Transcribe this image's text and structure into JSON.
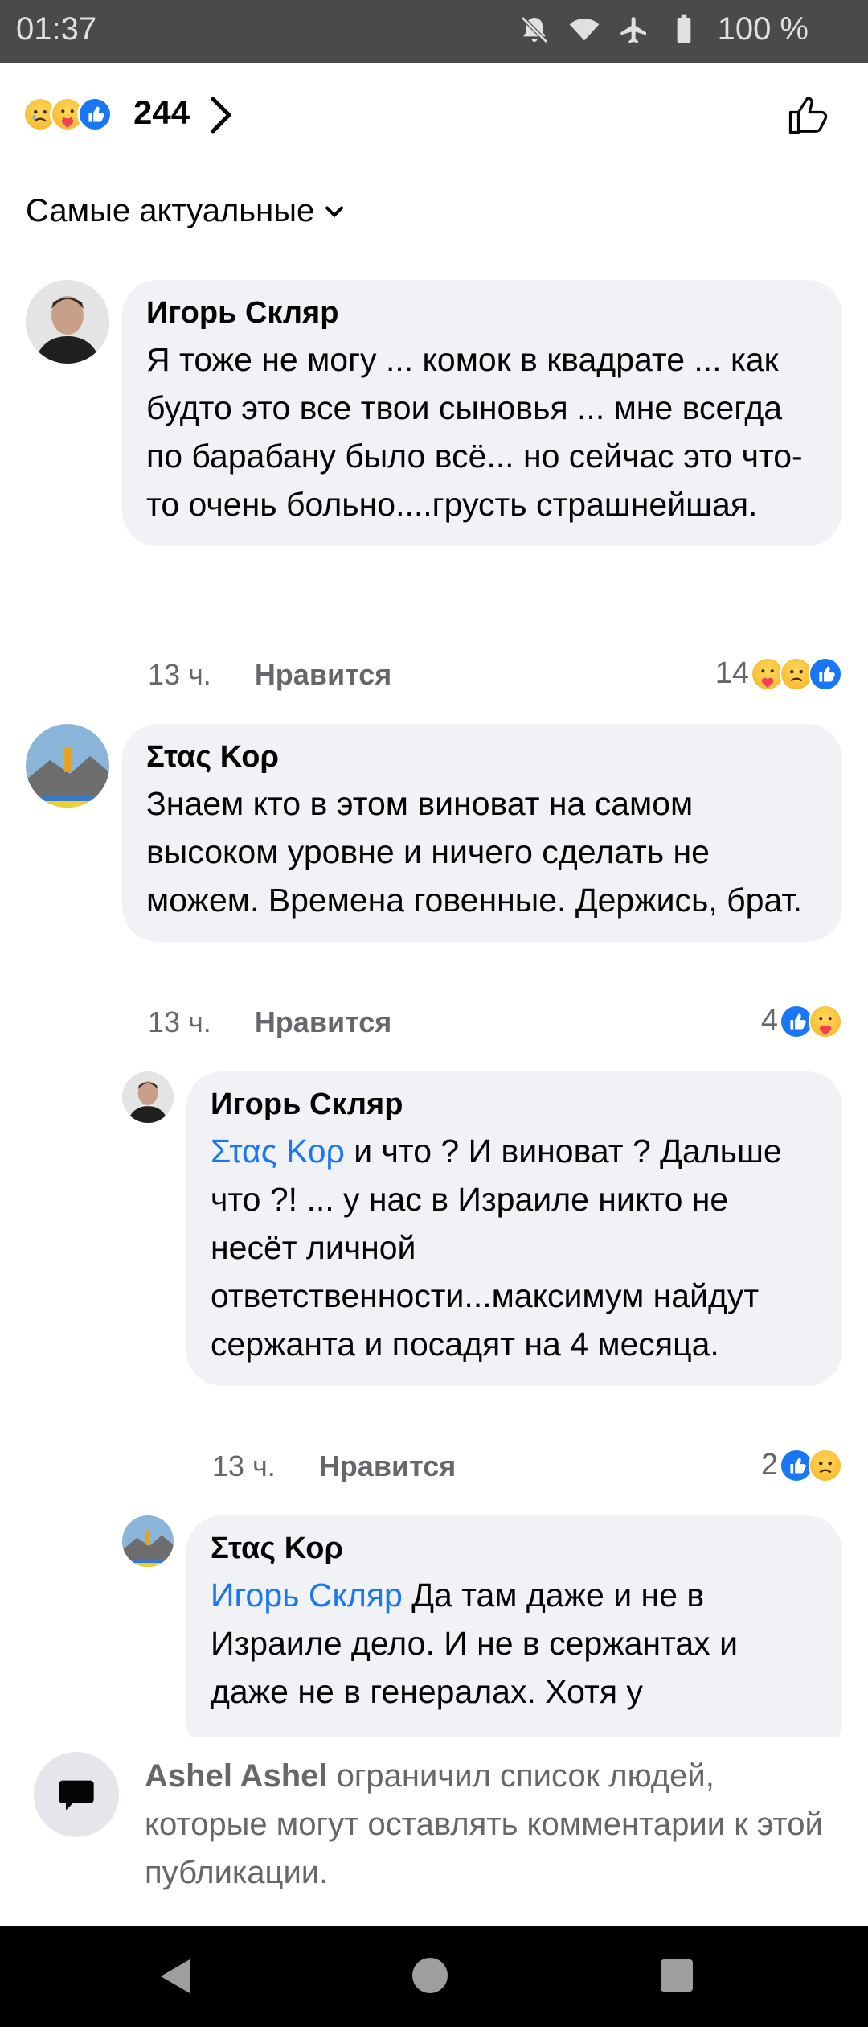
{
  "status_bar": {
    "time": "01:37",
    "battery": "100 %",
    "icons": [
      "notifications-off-icon",
      "wifi-icon",
      "airplane-icon",
      "battery-icon"
    ]
  },
  "reactions": {
    "count": "244",
    "types": [
      "sad",
      "care",
      "like"
    ]
  },
  "sort": {
    "label": "Самые актуальные"
  },
  "comments": [
    {
      "author": "Игорь Скляр",
      "text": "Я тоже не могу ... комок в квадрате ... как будто это все твои сыновья ... мне всегда по барабану было всё... но сейчас это что-то очень больно....грусть страшнейшая.",
      "time": "13 ч.",
      "like_label": "Нравится",
      "reaction_count": "14",
      "reaction_types": [
        "care",
        "sad",
        "like"
      ]
    },
    {
      "author": "Στας Κορ",
      "text": "Знаем кто в этом виноват на самом высоком уровне и ничего сделать не можем. Времена говенные. Держись, брат.",
      "time": "13 ч.",
      "like_label": "Нравится",
      "reaction_count": "4",
      "reaction_types": [
        "like",
        "care"
      ]
    },
    {
      "author": "Игорь Скляр",
      "mention": "Στας Κορ",
      "text": " и что ? И виноват ? Дальше что  ?! ... у нас в Израиле никто не несёт личной ответственности...максимум найдут сержанта и посадят на 4 месяца.",
      "time": "13 ч.",
      "like_label": "Нравится",
      "reaction_count": "2",
      "reaction_types": [
        "like",
        "sad"
      ]
    },
    {
      "author": "Στας Κορ",
      "mention": "Игорь Скляр",
      "text": " Да там даже и не в Израиле дело. И не в сержантах и даже не в генералах. Хотя у"
    }
  ],
  "footer": {
    "name": "Ashel Ashel",
    "message": " ограничил список людей, которые могут оставлять комментарии к этой публикации."
  },
  "colors": {
    "accent": "#1877f2",
    "bubble": "#f0f2f5",
    "meta": "#65676b",
    "status_bar": "#4a4a4a"
  }
}
